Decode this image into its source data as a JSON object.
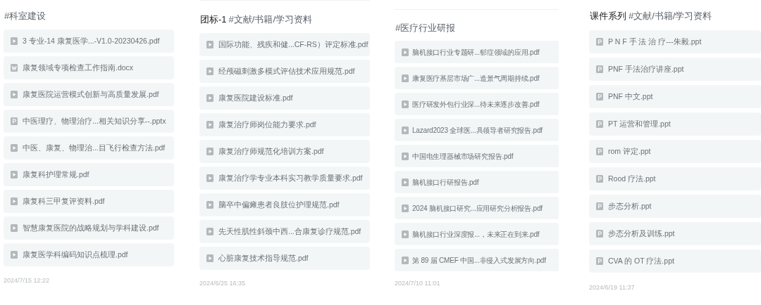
{
  "panels": [
    {
      "tag": "#科室建设",
      "files": [
        {
          "kind": "pdf",
          "name": "3 专业-14 康复医学...-V1.0-20230426.pdf"
        },
        {
          "kind": "doc",
          "name": "康复领域专项检查工作指南.docx"
        },
        {
          "kind": "pdf",
          "name": "康复医院运营模式创新与高质量发展.pdf"
        },
        {
          "kind": "ppt",
          "name": "中医理疗、物理治疗...相关知识分享--.pptx"
        },
        {
          "kind": "pdf",
          "name": "中医、康复、物理治...目飞行检查方法.pdf"
        },
        {
          "kind": "pdf",
          "name": "康复科护理常规.pdf"
        },
        {
          "kind": "pdf",
          "name": "康复科三甲复评资料.pdf"
        },
        {
          "kind": "pdf",
          "name": "智慧康复医院的战略规划与学科建设.pdf"
        },
        {
          "kind": "pdf",
          "name": "康复医学科编码知识点梳理.pdf"
        }
      ],
      "date": "2024/7/15 12:22"
    },
    {
      "title": "团标-1",
      "tag": "#文献/书籍/学习资料",
      "files": [
        {
          "kind": "pdf",
          "name": "国际功能、残疾和健...CF-RS）评定标准.pdf"
        },
        {
          "kind": "pdf",
          "name": "经颅磁刺激多模式评估技术应用规范.pdf"
        },
        {
          "kind": "pdf",
          "name": "康复医院建设标准.pdf"
        },
        {
          "kind": "pdf",
          "name": "康复治疗师岗位能力要求.pdf"
        },
        {
          "kind": "pdf",
          "name": "康复治疗师规范化培训方案.pdf"
        },
        {
          "kind": "pdf",
          "name": "康复治疗学专业本科实习教学质量要求.pdf"
        },
        {
          "kind": "pdf",
          "name": "脑卒中偏瘫患者良肢位护理规范.pdf"
        },
        {
          "kind": "pdf",
          "name": "先天性肌性斜颈中西...合康复诊疗规范.pdf"
        },
        {
          "kind": "pdf",
          "name": "心脏康复技术指导规范.pdf"
        }
      ],
      "date": "2024/6/25 16:35"
    },
    {
      "tag": "#医疗行业研报",
      "files": [
        {
          "kind": "pdf",
          "name": "脑机接口行业专题研...郁症领域的应用.pdf"
        },
        {
          "kind": "pdf",
          "name": "康复医疗基层市场广...造景气周期持续.pdf"
        },
        {
          "kind": "pdf",
          "name": "医疗研发外包行业深...待未来逐步改善.pdf"
        },
        {
          "kind": "pdf",
          "name": "Lazard2023 全球医...具领导者研究报告.pdf"
        },
        {
          "kind": "pdf",
          "name": "中国电生理器械市场研究报告.pdf"
        },
        {
          "kind": "pdf",
          "name": "脑机接口行研报告.pdf"
        },
        {
          "kind": "pdf",
          "name": "2024 脑机接口研究...应用研究分析报告.pdf"
        },
        {
          "kind": "pdf",
          "name": "脑机接口行业深度报...，未来正在到来.pdf"
        },
        {
          "kind": "pdf",
          "name": "第 89 届 CMEF 中国...非侵入式发展方向.pdf"
        }
      ],
      "date": "2024/7/10 11:01"
    },
    {
      "title": "课件系列",
      "tag": "#文献/书籍/学习资料",
      "files": [
        {
          "kind": "ppt",
          "name": "P N F 手 法 治 疗---朱毅.ppt"
        },
        {
          "kind": "ppt",
          "name": "PNF 手法治疗讲座.ppt"
        },
        {
          "kind": "ppt",
          "name": "PNF 中文.ppt"
        },
        {
          "kind": "ppt",
          "name": "PT 运营和管理.ppt"
        },
        {
          "kind": "ppt",
          "name": "rom 评定.ppt"
        },
        {
          "kind": "ppt",
          "name": "Rood 疗法.ppt"
        },
        {
          "kind": "ppt",
          "name": "步态分析.ppt"
        },
        {
          "kind": "ppt",
          "name": "步态分析及训练.ppt"
        },
        {
          "kind": "ppt",
          "name": "CVA 的 OT 疗法.ppt"
        }
      ],
      "date": "2024/6/19 11:37"
    }
  ]
}
